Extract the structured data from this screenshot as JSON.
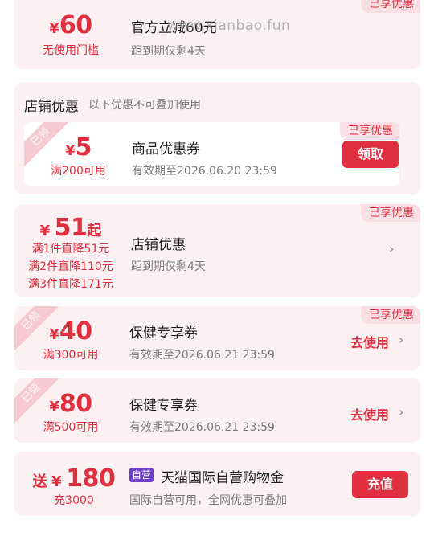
{
  "card1": {
    "tag": "已享优惠",
    "currency": "¥",
    "amount": "60",
    "condition": "无使用门槛",
    "title": "官方立减60元",
    "subtitle": "距到期仅剩4天"
  },
  "watermark": "www.xianbao.fun",
  "store_section": {
    "heading": "店铺优惠",
    "note": "以下优惠不可叠加使用",
    "coupon": {
      "claimed": "已领",
      "tag": "已享优惠",
      "currency": "¥",
      "amount": "5",
      "condition": "满200可用",
      "title": "商品优惠券",
      "subtitle": "有效期至2026.06.20 23:59",
      "button": "领取"
    }
  },
  "card3": {
    "tag": "已享优惠",
    "currency": "¥",
    "amount": "51",
    "suffix": "起",
    "tiers": [
      "满1件直降51元",
      "满2件直降110元",
      "满3件直降171元"
    ],
    "title": "店铺优惠",
    "subtitle": "距到期仅剩4天",
    "chevron": "›"
  },
  "card4": {
    "claimed": "已领",
    "tag": "已享优惠",
    "currency": "¥",
    "amount": "40",
    "condition": "满300可用",
    "title": "保健专享券",
    "subtitle": "有效期至2026.06.21 23:59",
    "action": "去使用",
    "chevron": "›"
  },
  "card5": {
    "claimed": "已领",
    "currency": "¥",
    "amount": "80",
    "condition": "满500可用",
    "title": "保健专享券",
    "subtitle": "有效期至2026.06.21 23:59",
    "action": "去使用",
    "chevron": "›"
  },
  "card6": {
    "prefix": "送",
    "currency": "¥",
    "amount": "180",
    "condition": "充3000",
    "badge": "自营",
    "title": "天猫国际自营购物金",
    "subtitle": "国际自营可用，全网优惠可叠加",
    "button": "充值"
  },
  "colors": {
    "accent": "#e0303f",
    "card_bg": "#fdf0f2",
    "badge_purple": "#7040c8"
  }
}
